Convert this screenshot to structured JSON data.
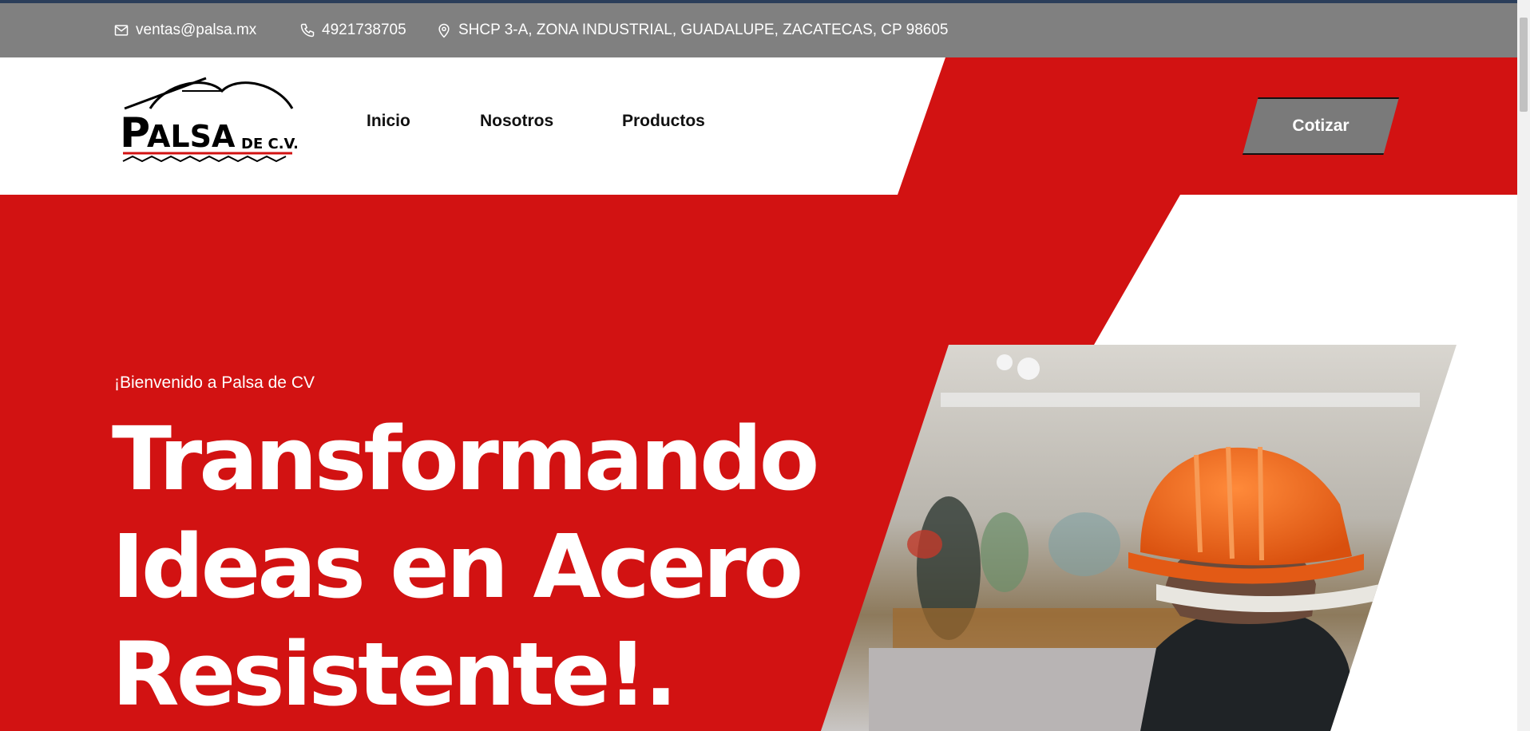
{
  "topbar": {
    "email": "ventas@palsa.mx",
    "phone": "4921738705",
    "address": "SHCP 3-A, ZONA INDUSTRIAL, GUADALUPE, ZACATECAS, CP 98605"
  },
  "logo": {
    "text": "PALSA DE C.V."
  },
  "nav": {
    "items": [
      {
        "label": "Inicio"
      },
      {
        "label": "Nosotros"
      },
      {
        "label": "Productos"
      }
    ]
  },
  "cta": {
    "label": "Cotizar"
  },
  "hero": {
    "welcome": "¡Bienvenido a Palsa de CV",
    "title_lines": [
      "Transformando",
      "Ideas en Acero",
      "Resistente!."
    ]
  },
  "colors": {
    "red": "#d21212",
    "gray": "#808080",
    "white": "#ffffff",
    "helmet": "#f26522"
  },
  "icons": [
    "envelope-icon",
    "phone-icon",
    "map-pin-icon"
  ]
}
